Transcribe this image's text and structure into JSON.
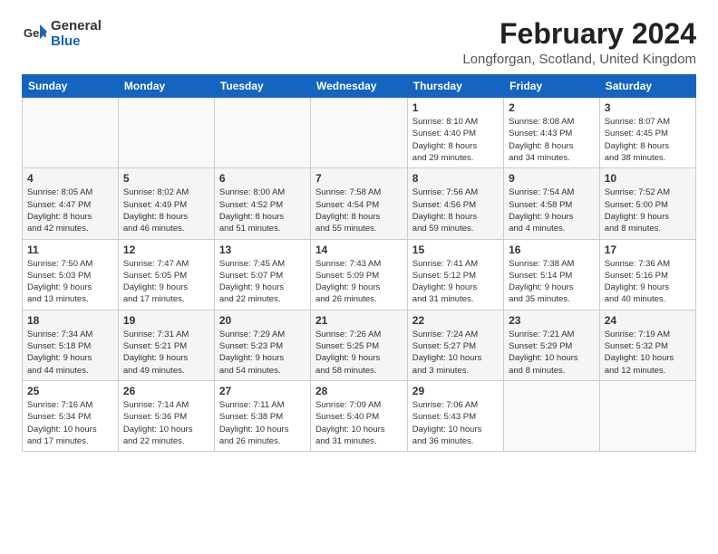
{
  "header": {
    "logo_line1": "General",
    "logo_line2": "Blue",
    "month_title": "February 2024",
    "location": "Longforgan, Scotland, United Kingdom"
  },
  "days_of_week": [
    "Sunday",
    "Monday",
    "Tuesday",
    "Wednesday",
    "Thursday",
    "Friday",
    "Saturday"
  ],
  "weeks": [
    [
      {
        "day": "",
        "info": ""
      },
      {
        "day": "",
        "info": ""
      },
      {
        "day": "",
        "info": ""
      },
      {
        "day": "",
        "info": ""
      },
      {
        "day": "1",
        "info": "Sunrise: 8:10 AM\nSunset: 4:40 PM\nDaylight: 8 hours\nand 29 minutes."
      },
      {
        "day": "2",
        "info": "Sunrise: 8:08 AM\nSunset: 4:43 PM\nDaylight: 8 hours\nand 34 minutes."
      },
      {
        "day": "3",
        "info": "Sunrise: 8:07 AM\nSunset: 4:45 PM\nDaylight: 8 hours\nand 38 minutes."
      }
    ],
    [
      {
        "day": "4",
        "info": "Sunrise: 8:05 AM\nSunset: 4:47 PM\nDaylight: 8 hours\nand 42 minutes."
      },
      {
        "day": "5",
        "info": "Sunrise: 8:02 AM\nSunset: 4:49 PM\nDaylight: 8 hours\nand 46 minutes."
      },
      {
        "day": "6",
        "info": "Sunrise: 8:00 AM\nSunset: 4:52 PM\nDaylight: 8 hours\nand 51 minutes."
      },
      {
        "day": "7",
        "info": "Sunrise: 7:58 AM\nSunset: 4:54 PM\nDaylight: 8 hours\nand 55 minutes."
      },
      {
        "day": "8",
        "info": "Sunrise: 7:56 AM\nSunset: 4:56 PM\nDaylight: 8 hours\nand 59 minutes."
      },
      {
        "day": "9",
        "info": "Sunrise: 7:54 AM\nSunset: 4:58 PM\nDaylight: 9 hours\nand 4 minutes."
      },
      {
        "day": "10",
        "info": "Sunrise: 7:52 AM\nSunset: 5:00 PM\nDaylight: 9 hours\nand 8 minutes."
      }
    ],
    [
      {
        "day": "11",
        "info": "Sunrise: 7:50 AM\nSunset: 5:03 PM\nDaylight: 9 hours\nand 13 minutes."
      },
      {
        "day": "12",
        "info": "Sunrise: 7:47 AM\nSunset: 5:05 PM\nDaylight: 9 hours\nand 17 minutes."
      },
      {
        "day": "13",
        "info": "Sunrise: 7:45 AM\nSunset: 5:07 PM\nDaylight: 9 hours\nand 22 minutes."
      },
      {
        "day": "14",
        "info": "Sunrise: 7:43 AM\nSunset: 5:09 PM\nDaylight: 9 hours\nand 26 minutes."
      },
      {
        "day": "15",
        "info": "Sunrise: 7:41 AM\nSunset: 5:12 PM\nDaylight: 9 hours\nand 31 minutes."
      },
      {
        "day": "16",
        "info": "Sunrise: 7:38 AM\nSunset: 5:14 PM\nDaylight: 9 hours\nand 35 minutes."
      },
      {
        "day": "17",
        "info": "Sunrise: 7:36 AM\nSunset: 5:16 PM\nDaylight: 9 hours\nand 40 minutes."
      }
    ],
    [
      {
        "day": "18",
        "info": "Sunrise: 7:34 AM\nSunset: 5:18 PM\nDaylight: 9 hours\nand 44 minutes."
      },
      {
        "day": "19",
        "info": "Sunrise: 7:31 AM\nSunset: 5:21 PM\nDaylight: 9 hours\nand 49 minutes."
      },
      {
        "day": "20",
        "info": "Sunrise: 7:29 AM\nSunset: 5:23 PM\nDaylight: 9 hours\nand 54 minutes."
      },
      {
        "day": "21",
        "info": "Sunrise: 7:26 AM\nSunset: 5:25 PM\nDaylight: 9 hours\nand 58 minutes."
      },
      {
        "day": "22",
        "info": "Sunrise: 7:24 AM\nSunset: 5:27 PM\nDaylight: 10 hours\nand 3 minutes."
      },
      {
        "day": "23",
        "info": "Sunrise: 7:21 AM\nSunset: 5:29 PM\nDaylight: 10 hours\nand 8 minutes."
      },
      {
        "day": "24",
        "info": "Sunrise: 7:19 AM\nSunset: 5:32 PM\nDaylight: 10 hours\nand 12 minutes."
      }
    ],
    [
      {
        "day": "25",
        "info": "Sunrise: 7:16 AM\nSunset: 5:34 PM\nDaylight: 10 hours\nand 17 minutes."
      },
      {
        "day": "26",
        "info": "Sunrise: 7:14 AM\nSunset: 5:36 PM\nDaylight: 10 hours\nand 22 minutes."
      },
      {
        "day": "27",
        "info": "Sunrise: 7:11 AM\nSunset: 5:38 PM\nDaylight: 10 hours\nand 26 minutes."
      },
      {
        "day": "28",
        "info": "Sunrise: 7:09 AM\nSunset: 5:40 PM\nDaylight: 10 hours\nand 31 minutes."
      },
      {
        "day": "29",
        "info": "Sunrise: 7:06 AM\nSunset: 5:43 PM\nDaylight: 10 hours\nand 36 minutes."
      },
      {
        "day": "",
        "info": ""
      },
      {
        "day": "",
        "info": ""
      }
    ]
  ]
}
